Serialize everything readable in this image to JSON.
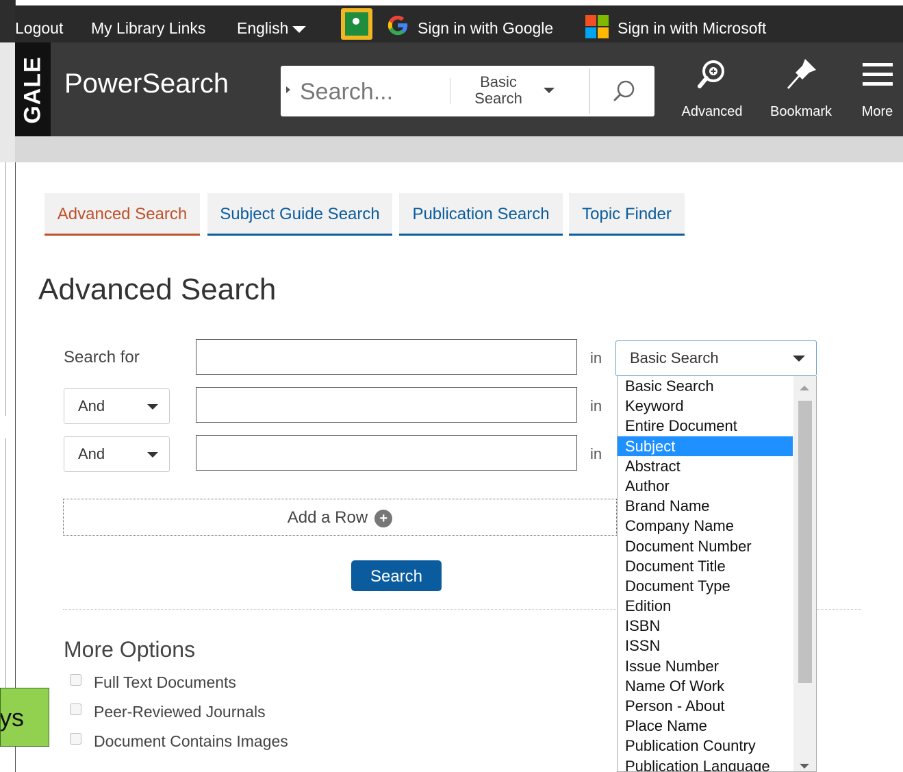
{
  "topbar": {
    "logout": "Logout",
    "library_links": "My Library Links",
    "language": "English",
    "google_signin": "Sign in with Google",
    "microsoft_signin": "Sign in with Microsoft"
  },
  "header": {
    "logo": "GALE",
    "brand": "PowerSearch",
    "search_placeholder": "Search...",
    "search_mode": "Basic Search",
    "actions": {
      "advanced": "Advanced",
      "bookmark": "Bookmark",
      "more": "More"
    }
  },
  "tabs": [
    {
      "label": "Advanced Search",
      "active": true
    },
    {
      "label": "Subject Guide Search",
      "active": false
    },
    {
      "label": "Publication Search",
      "active": false
    },
    {
      "label": "Topic Finder",
      "active": false
    }
  ],
  "page_title": "Advanced Search",
  "form": {
    "search_for_label": "Search for",
    "in_label": "in",
    "operators": [
      "And",
      "And"
    ],
    "field_selected": "Basic Search",
    "field_options": [
      "Basic Search",
      "Keyword",
      "Entire Document",
      "Subject",
      "Abstract",
      "Author",
      "Brand Name",
      "Company Name",
      "Document Number",
      "Document Title",
      "Document Type",
      "Edition",
      "ISBN",
      "ISSN",
      "Issue Number",
      "Name Of Work",
      "Person - About",
      "Place Name",
      "Publication Country",
      "Publication Language"
    ],
    "highlighted_option": "Subject",
    "add_row": "Add a Row",
    "search_button": "Search"
  },
  "more_options": {
    "title": "More Options",
    "checkboxes": [
      "Full Text Documents",
      "Peer-Reviewed Journals",
      "Document Contains Images"
    ]
  },
  "side_tab": "ays",
  "colors": {
    "accent": "#0a5c9e",
    "active_tab": "#c0502a",
    "highlight": "#1e90ff",
    "side_tab": "#92d050"
  }
}
